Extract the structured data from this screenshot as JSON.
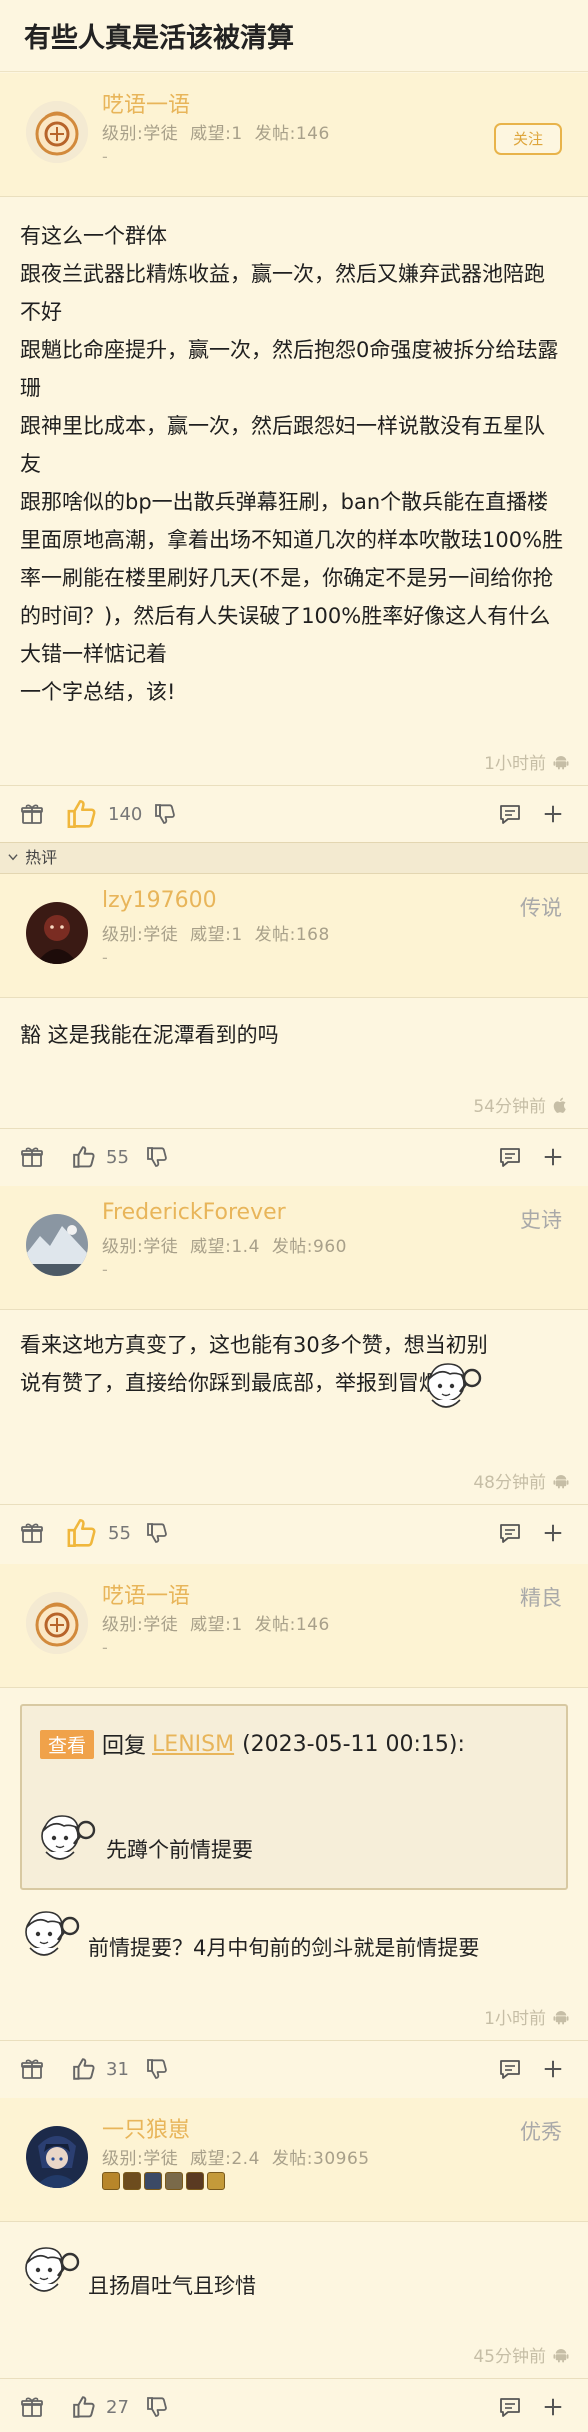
{
  "page": {
    "title": "有些人真是活该被清算"
  },
  "hot_label": "热评",
  "posts": [
    {
      "username": "呓语一语",
      "level": "级别:学徒",
      "prestige": "威望:1",
      "post_count": "发帖:146",
      "signature": "-",
      "follow_label": "关注",
      "body": [
        "有这么一个群体",
        "跟夜兰武器比精炼收益，赢一次，然后又嫌弃武器池陪跑不好",
        "跟魈比命座提升，赢一次，然后抱怨0命强度被拆分给珐露珊",
        "跟神里比成本，赢一次，然后跟怨妇一样说散没有五星队友",
        "跟那啥似的bp一出散兵弹幕狂刷，ban个散兵能在直播楼里面原地高潮，拿着出场不知道几次的样本吹散珐100%胜率一刷能在楼里刷好几天(不是，你确定不是另一间给你抢的时间？)，然后有人失误破了100%胜率好像这人有什么大错一样惦记着",
        "一个字总结，该!"
      ],
      "time": "1小时前",
      "likes": "140"
    },
    {
      "username": "lzy197600",
      "level": "级别:学徒",
      "prestige": "威望:1",
      "post_count": "发帖:168",
      "signature": "-",
      "tag": "传说",
      "body": "豁 这是我能在泥潭看到的吗",
      "time": "54分钟前",
      "likes": "55"
    },
    {
      "username": "FrederickForever",
      "level": "级别:学徒",
      "prestige": "威望:1.4",
      "post_count": "发帖:960",
      "signature": "-",
      "tag": "史诗",
      "body": "看来这地方真变了，这也能有30多个赞，想当初别说有赞了，直接给你踩到最底部，举报到冒烟",
      "time": "48分钟前",
      "likes": "55"
    },
    {
      "username": "呓语一语",
      "level": "级别:学徒",
      "prestige": "威望:1",
      "post_count": "发帖:146",
      "signature": "-",
      "tag": "精良",
      "quote_label": "查看",
      "quote_reply": "回复",
      "quote_user": "LENISM",
      "quote_date": "(2023-05-11 00:15):",
      "quote_text": "先蹲个前情提要",
      "body": "前情提要？4月中旬前的剑斗就是前情提要",
      "time": "1小时前",
      "likes": "31"
    },
    {
      "username": "一只狼崽",
      "level": "级别:学徒",
      "prestige": "威望:2.4",
      "post_count": "发帖:30965",
      "tag": "优秀",
      "body": "且扬眉吐气且珍惜",
      "time": "45分钟前",
      "likes": "27"
    }
  ],
  "icons": {
    "gift": "gift-icon",
    "like": "thumbs-up-icon",
    "dislike": "thumbs-down-icon",
    "comment": "comment-icon",
    "more": "plus-icon",
    "android": "android-icon",
    "apple": "apple-icon"
  },
  "colors": {
    "accent": "#e8b55a",
    "background": "#fdf6e0",
    "header_bg": "#fdf3d3",
    "like_active": "#f0b73c"
  }
}
